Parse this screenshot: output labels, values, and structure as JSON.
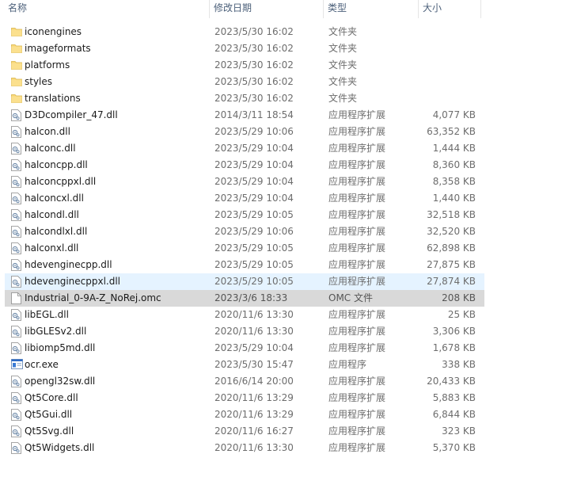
{
  "columns": {
    "name": "名称",
    "date": "修改日期",
    "type": "类型",
    "size": "大小"
  },
  "files": [
    {
      "name": "iconengines",
      "date": "2023/5/30 16:02",
      "type": "文件夹",
      "size": "",
      "icon": "folder-icon"
    },
    {
      "name": "imageformats",
      "date": "2023/5/30 16:02",
      "type": "文件夹",
      "size": "",
      "icon": "folder-icon"
    },
    {
      "name": "platforms",
      "date": "2023/5/30 16:02",
      "type": "文件夹",
      "size": "",
      "icon": "folder-icon"
    },
    {
      "name": "styles",
      "date": "2023/5/30 16:02",
      "type": "文件夹",
      "size": "",
      "icon": "folder-icon"
    },
    {
      "name": "translations",
      "date": "2023/5/30 16:02",
      "type": "文件夹",
      "size": "",
      "icon": "folder-icon"
    },
    {
      "name": "D3Dcompiler_47.dll",
      "date": "2014/3/11 18:54",
      "type": "应用程序扩展",
      "size": "4,077 KB",
      "icon": "dll-icon"
    },
    {
      "name": "halcon.dll",
      "date": "2023/5/29 10:06",
      "type": "应用程序扩展",
      "size": "63,352 KB",
      "icon": "dll-icon"
    },
    {
      "name": "halconc.dll",
      "date": "2023/5/29 10:04",
      "type": "应用程序扩展",
      "size": "1,444 KB",
      "icon": "dll-icon"
    },
    {
      "name": "halconcpp.dll",
      "date": "2023/5/29 10:04",
      "type": "应用程序扩展",
      "size": "8,360 KB",
      "icon": "dll-icon"
    },
    {
      "name": "halconcppxl.dll",
      "date": "2023/5/29 10:04",
      "type": "应用程序扩展",
      "size": "8,358 KB",
      "icon": "dll-icon"
    },
    {
      "name": "halconcxl.dll",
      "date": "2023/5/29 10:04",
      "type": "应用程序扩展",
      "size": "1,440 KB",
      "icon": "dll-icon"
    },
    {
      "name": "halcondl.dll",
      "date": "2023/5/29 10:05",
      "type": "应用程序扩展",
      "size": "32,518 KB",
      "icon": "dll-icon"
    },
    {
      "name": "halcondlxl.dll",
      "date": "2023/5/29 10:06",
      "type": "应用程序扩展",
      "size": "32,520 KB",
      "icon": "dll-icon"
    },
    {
      "name": "halconxl.dll",
      "date": "2023/5/29 10:05",
      "type": "应用程序扩展",
      "size": "62,898 KB",
      "icon": "dll-icon"
    },
    {
      "name": "hdevenginecpp.dll",
      "date": "2023/5/29 10:05",
      "type": "应用程序扩展",
      "size": "27,875 KB",
      "icon": "dll-icon"
    },
    {
      "name": "hdevenginecppxl.dll",
      "date": "2023/5/29 10:05",
      "type": "应用程序扩展",
      "size": "27,874 KB",
      "icon": "dll-icon",
      "state": "hover"
    },
    {
      "name": "Industrial_0-9A-Z_NoRej.omc",
      "date": "2023/3/6 18:33",
      "type": "OMC 文件",
      "size": "208 KB",
      "icon": "file-icon",
      "state": "selected"
    },
    {
      "name": "libEGL.dll",
      "date": "2020/11/6 13:30",
      "type": "应用程序扩展",
      "size": "25 KB",
      "icon": "dll-icon"
    },
    {
      "name": "libGLESv2.dll",
      "date": "2020/11/6 13:30",
      "type": "应用程序扩展",
      "size": "3,306 KB",
      "icon": "dll-icon"
    },
    {
      "name": "libiomp5md.dll",
      "date": "2023/5/29 10:04",
      "type": "应用程序扩展",
      "size": "1,678 KB",
      "icon": "dll-icon"
    },
    {
      "name": "ocr.exe",
      "date": "2023/5/30 15:47",
      "type": "应用程序",
      "size": "338 KB",
      "icon": "exe-icon"
    },
    {
      "name": "opengl32sw.dll",
      "date": "2016/6/14 20:00",
      "type": "应用程序扩展",
      "size": "20,433 KB",
      "icon": "dll-icon"
    },
    {
      "name": "Qt5Core.dll",
      "date": "2020/11/6 13:29",
      "type": "应用程序扩展",
      "size": "5,883 KB",
      "icon": "dll-icon"
    },
    {
      "name": "Qt5Gui.dll",
      "date": "2020/11/6 13:29",
      "type": "应用程序扩展",
      "size": "6,844 KB",
      "icon": "dll-icon"
    },
    {
      "name": "Qt5Svg.dll",
      "date": "2020/11/6 16:27",
      "type": "应用程序扩展",
      "size": "323 KB",
      "icon": "dll-icon"
    },
    {
      "name": "Qt5Widgets.dll",
      "date": "2020/11/6 13:30",
      "type": "应用程序扩展",
      "size": "5,370 KB",
      "icon": "dll-icon"
    }
  ],
  "colors": {
    "hover": "#e5f3ff",
    "selected": "#d9d9d9",
    "folder": "#f8d775",
    "header_text": "#4c607a"
  }
}
